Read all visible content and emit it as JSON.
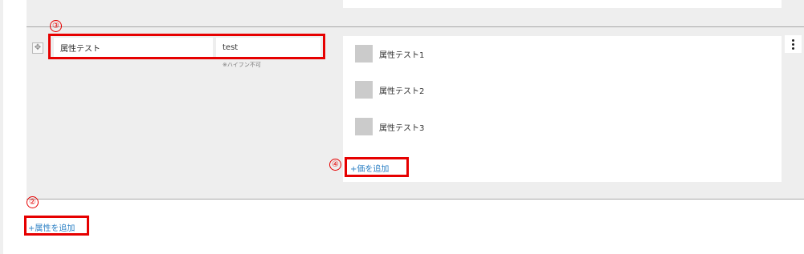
{
  "attribute": {
    "name_value": "属性テスト",
    "key_value": "test",
    "key_note": "※ハイフン不可",
    "values": [
      {
        "label": "属性テスト1"
      },
      {
        "label": "属性テスト2"
      },
      {
        "label": "属性テスト3"
      }
    ],
    "add_value_label": "+価を追加",
    "menu_icon": "vertical-ellipsis",
    "move_icon": "four-way-arrows"
  },
  "footer": {
    "add_attribute_label": "+属性を追加"
  },
  "annotations": {
    "marker_3": "③",
    "marker_4": "④",
    "marker_2": "②",
    "color": "#e60000"
  },
  "colors": {
    "link": "#2a7fc4",
    "row_background": "#eeeeee",
    "thumb": "#cbcbcb"
  }
}
